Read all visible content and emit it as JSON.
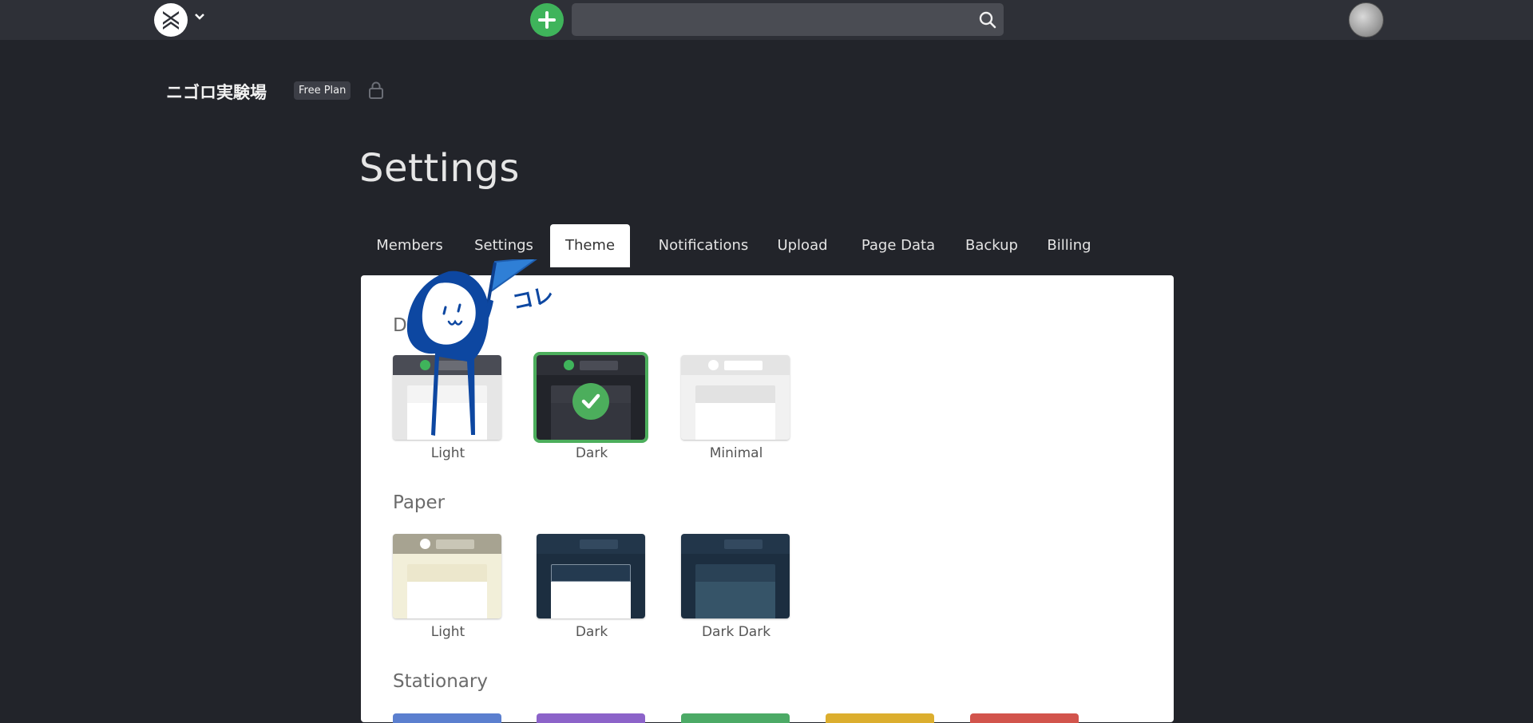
{
  "header": {
    "search_placeholder": "",
    "new_page_label": "New page",
    "avatar_label": "User avatar"
  },
  "project": {
    "name": "ニゴロ実験場",
    "plan_badge": "Free Plan"
  },
  "page_title": "Settings",
  "tabs": [
    {
      "label": "Members",
      "active": false
    },
    {
      "label": "Settings",
      "active": false
    },
    {
      "label": "Theme",
      "active": true
    },
    {
      "label": "Notifications",
      "active": false
    },
    {
      "label": "Upload",
      "active": false
    },
    {
      "label": "Page Data",
      "active": false
    },
    {
      "label": "Backup",
      "active": false
    },
    {
      "label": "Billing",
      "active": false
    }
  ],
  "sections": {
    "default": {
      "heading": "D"
    },
    "paper": {
      "heading": "Paper"
    },
    "stationary": {
      "heading": "Stationary"
    }
  },
  "themes": {
    "default_light": {
      "label": "Light"
    },
    "default_dark": {
      "label": "Dark",
      "selected": true
    },
    "default_minimal": {
      "label": "Minimal"
    },
    "paper_light": {
      "label": "Light"
    },
    "paper_dark": {
      "label": "Dark"
    },
    "paper_dark_dark": {
      "label": "Dark Dark"
    }
  },
  "mascot_text": "コレ",
  "colors": {
    "accent_green": "#3fb45b",
    "topbar": "#2e3037",
    "background": "#22242a",
    "stationary_blue": "#5b7fcf",
    "stationary_purple": "#8c63c9",
    "stationary_green": "#4caa66",
    "stationary_yellow": "#dcae2e",
    "stationary_red": "#d2544c"
  }
}
